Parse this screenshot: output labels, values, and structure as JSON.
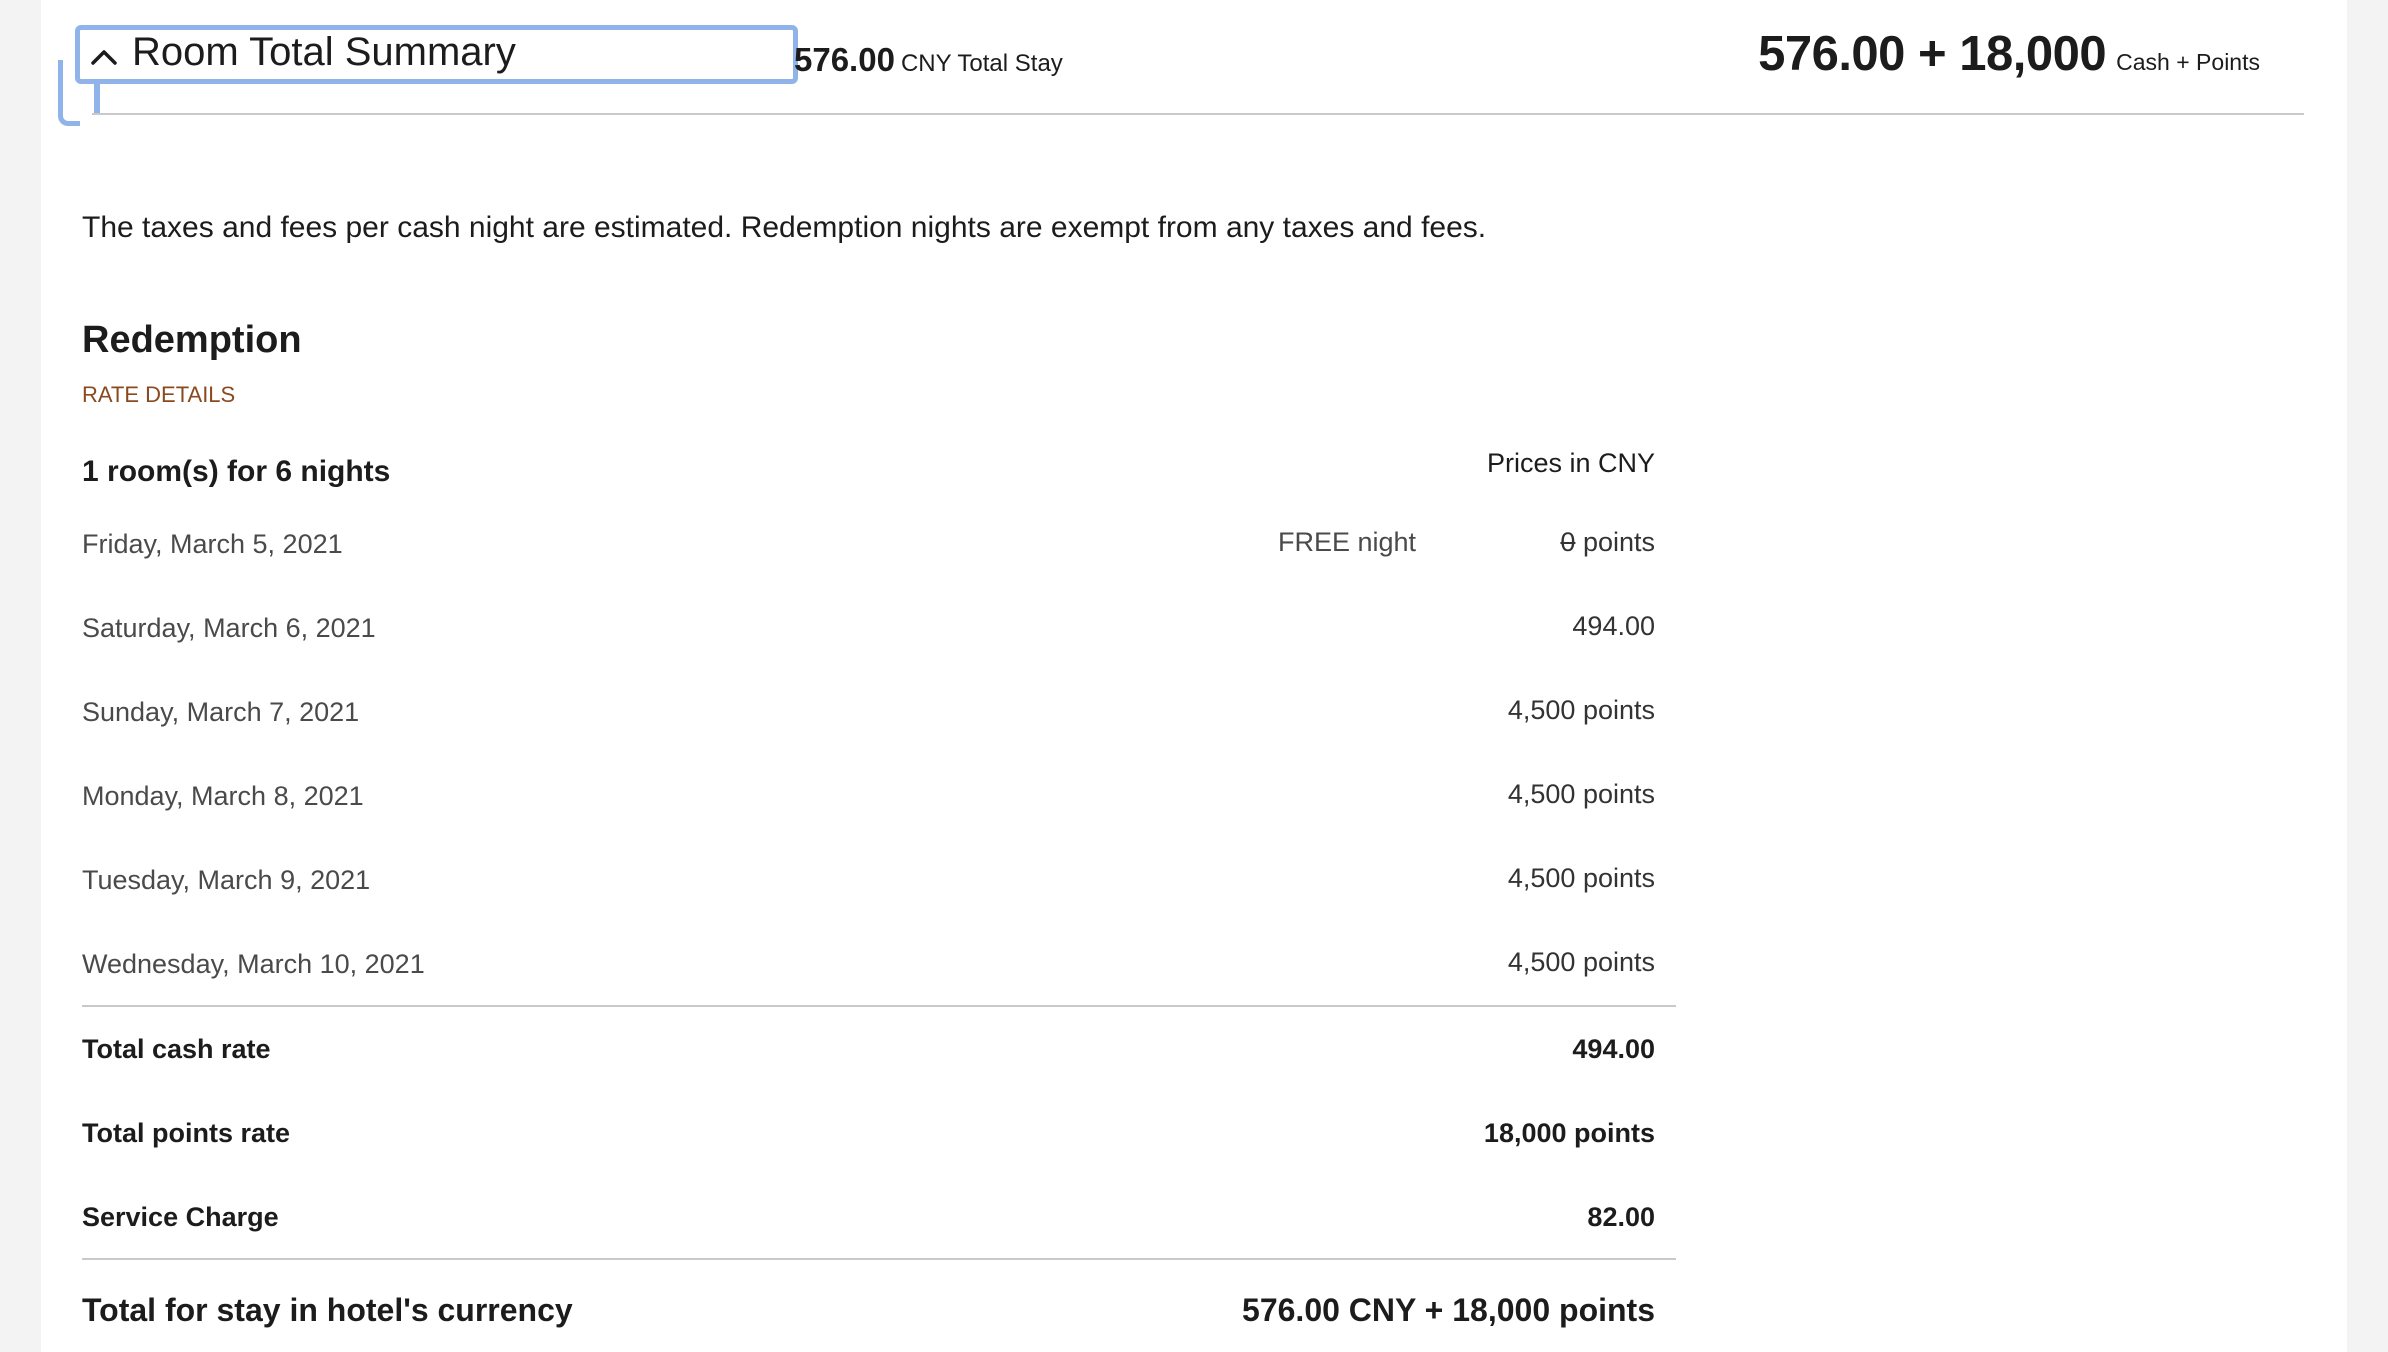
{
  "header": {
    "title": "Room Total Summary",
    "toggle_icon": "chevron-up-icon",
    "total_amount": "576.00",
    "total_label": "CNY Total Stay",
    "cash_points_amount": "576.00 + 18,000",
    "cash_points_label": "Cash + Points",
    "focus_color": "#90b4ea"
  },
  "notice": "The taxes and fees per cash night are estimated. Redemption nights are exempt from any taxes and fees.",
  "redemption": {
    "title": "Redemption",
    "rate_details_link": "RATE DETAILS",
    "rate_details_color": "#8a4a1f",
    "rooms_label": "1 room(s) for 6 nights",
    "prices_in": "Prices in CNY",
    "nights": [
      {
        "date": "Friday, March 5, 2021",
        "note": "FREE night",
        "value_struck": "0",
        "value": " points"
      },
      {
        "date": "Saturday, March 6, 2021",
        "note": "",
        "value_struck": "",
        "value": "494.00"
      },
      {
        "date": "Sunday, March 7, 2021",
        "note": "",
        "value_struck": "",
        "value": "4,500 points"
      },
      {
        "date": "Monday, March 8, 2021",
        "note": "",
        "value_struck": "",
        "value": "4,500 points"
      },
      {
        "date": "Tuesday, March 9, 2021",
        "note": "",
        "value_struck": "",
        "value": "4,500 points"
      },
      {
        "date": "Wednesday, March 10, 2021",
        "note": "",
        "value_struck": "",
        "value": "4,500 points"
      }
    ],
    "totals": [
      {
        "label": "Total cash rate",
        "value": "494.00"
      },
      {
        "label": "Total points rate",
        "value": "18,000 points"
      },
      {
        "label": "Service Charge",
        "value": "82.00"
      }
    ],
    "grand_total": {
      "label": "Total for stay in hotel's currency",
      "value": "576.00 CNY + 18,000 points"
    }
  }
}
